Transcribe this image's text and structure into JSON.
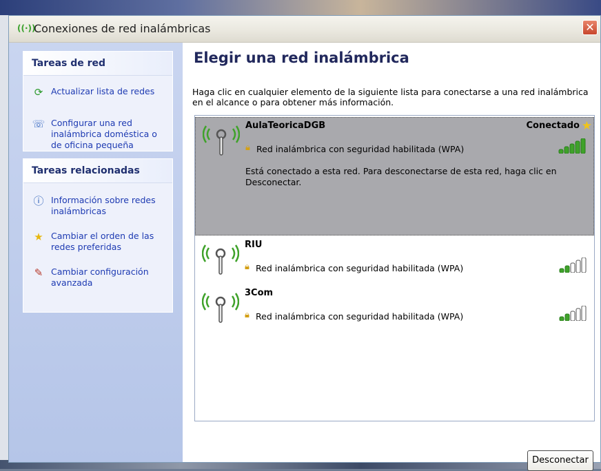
{
  "window": {
    "title": "Conexiones de red inalámbricas",
    "close_label": "✕"
  },
  "sidebar": {
    "network_tasks": {
      "header": "Tareas de red",
      "items": [
        {
          "label": "Actualizar lista de redes",
          "icon": "refresh-icon"
        },
        {
          "label": "Configurar una red inalámbrica doméstica o de oficina pequeña",
          "icon": "wireless-setup-icon"
        }
      ]
    },
    "related_tasks": {
      "header": "Tareas relacionadas",
      "items": [
        {
          "label": "Información sobre redes inalámbricas",
          "icon": "info-icon"
        },
        {
          "label": "Cambiar el orden de las redes preferidas",
          "icon": "star-icon"
        },
        {
          "label": "Cambiar configuración avanzada",
          "icon": "settings-icon"
        }
      ]
    }
  },
  "main": {
    "title": "Elegir una red inalámbrica",
    "description": "Haga clic en cualquier elemento de la siguiente lista para conectarse a una red inalámbrica en el alcance o para obtener más información.",
    "networks": [
      {
        "name": "AulaTeoricaDGB",
        "status": "Conectado",
        "security": "Red inalámbrica con seguridad habilitada (WPA)",
        "signal_bars": 5,
        "info": "Está conectado a esta red. Para desconectarse de esta red, haga clic en Desconectar."
      },
      {
        "name": "RIU",
        "security": "Red inalámbrica con seguridad habilitada (WPA)",
        "signal_bars": 2
      },
      {
        "name": "3Com",
        "security": "Red inalámbrica con seguridad habilitada (WPA)",
        "signal_bars": 2
      }
    ],
    "disconnect_button": "Desconectar"
  },
  "colors": {
    "signal_on": "#3fa22a",
    "signal_off": "#ffffff",
    "selected_bg": "#a9a9ad"
  }
}
